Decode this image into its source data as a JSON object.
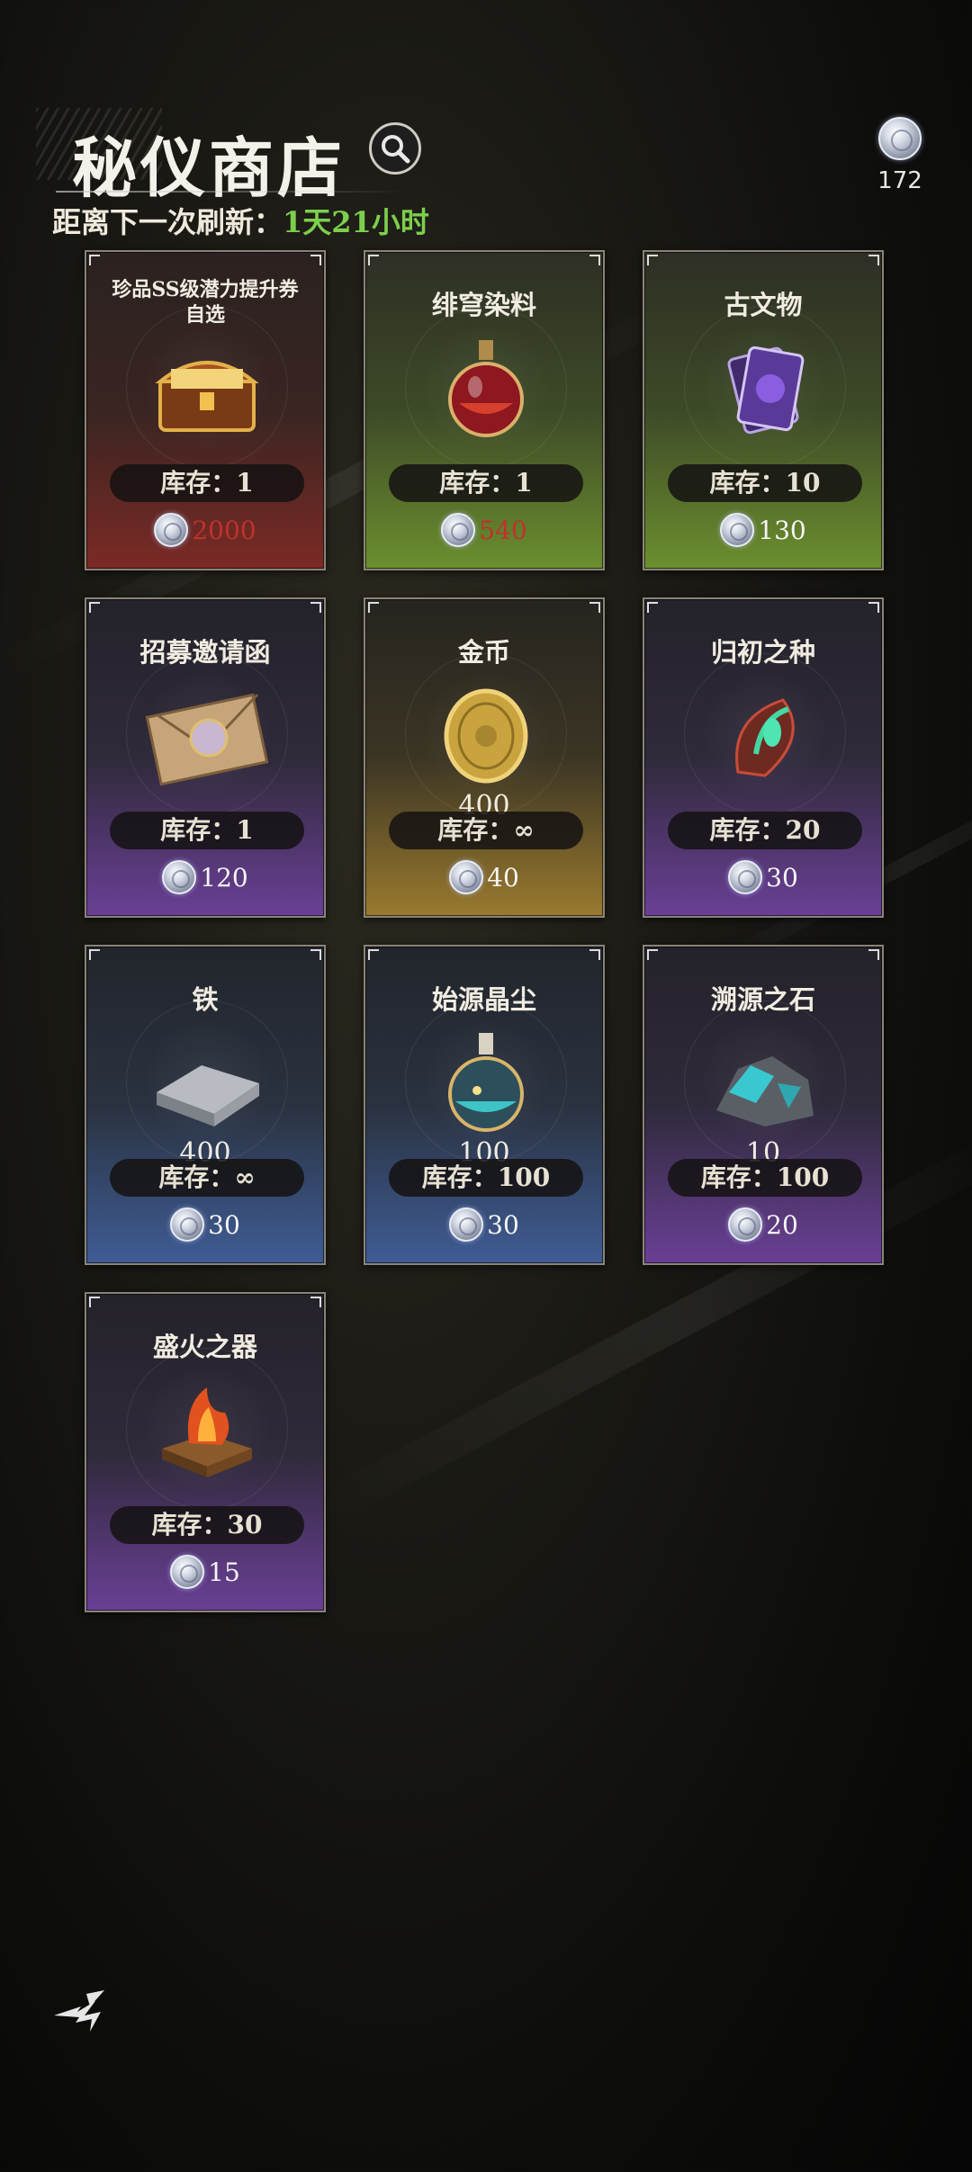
{
  "header": {
    "title": "秘仪商店",
    "refresh_label": "距离下一次刷新：",
    "refresh_time": "1天21小时",
    "currency_amount": "172"
  },
  "colors": {
    "refresh_time": "#7ccf4c",
    "unaffordable_price": "#c0312b",
    "currency_coin": "#d6dbe6"
  },
  "items": [
    {
      "name": "珍品SS级潜力提升券自选",
      "quantity": "",
      "stock": "库存：1",
      "price": "2000",
      "rarity": "red",
      "affordable": false,
      "icon": "treasure-chest-icon"
    },
    {
      "name": "绯穹染料",
      "quantity": "",
      "stock": "库存：1",
      "price": "540",
      "rarity": "green",
      "affordable": false,
      "icon": "potion-flask-icon"
    },
    {
      "name": "古文物",
      "quantity": "",
      "stock": "库存：10",
      "price": "130",
      "rarity": "green",
      "affordable": true,
      "icon": "artifact-cards-icon"
    },
    {
      "name": "招募邀请函",
      "quantity": "",
      "stock": "库存：1",
      "price": "120",
      "rarity": "purple",
      "affordable": true,
      "icon": "envelope-icon"
    },
    {
      "name": "金币",
      "quantity": "400",
      "stock": "库存：∞",
      "price": "40",
      "rarity": "gold",
      "affordable": true,
      "icon": "gold-coin-icon"
    },
    {
      "name": "归初之种",
      "quantity": "",
      "stock": "库存：20",
      "price": "30",
      "rarity": "purple",
      "affordable": true,
      "icon": "seed-icon"
    },
    {
      "name": "铁",
      "quantity": "400",
      "stock": "库存：∞",
      "price": "30",
      "rarity": "blue",
      "affordable": true,
      "icon": "iron-ingot-icon"
    },
    {
      "name": "始源晶尘",
      "quantity": "100",
      "stock": "库存：100",
      "price": "30",
      "rarity": "blue",
      "affordable": true,
      "icon": "crystal-dust-flask-icon"
    },
    {
      "name": "溯源之石",
      "quantity": "10",
      "stock": "库存：100",
      "price": "20",
      "rarity": "purple",
      "affordable": true,
      "icon": "ore-stone-icon"
    },
    {
      "name": "盛火之器",
      "quantity": "",
      "stock": "库存：30",
      "price": "15",
      "rarity": "purple",
      "affordable": true,
      "icon": "fire-vessel-icon"
    }
  ]
}
